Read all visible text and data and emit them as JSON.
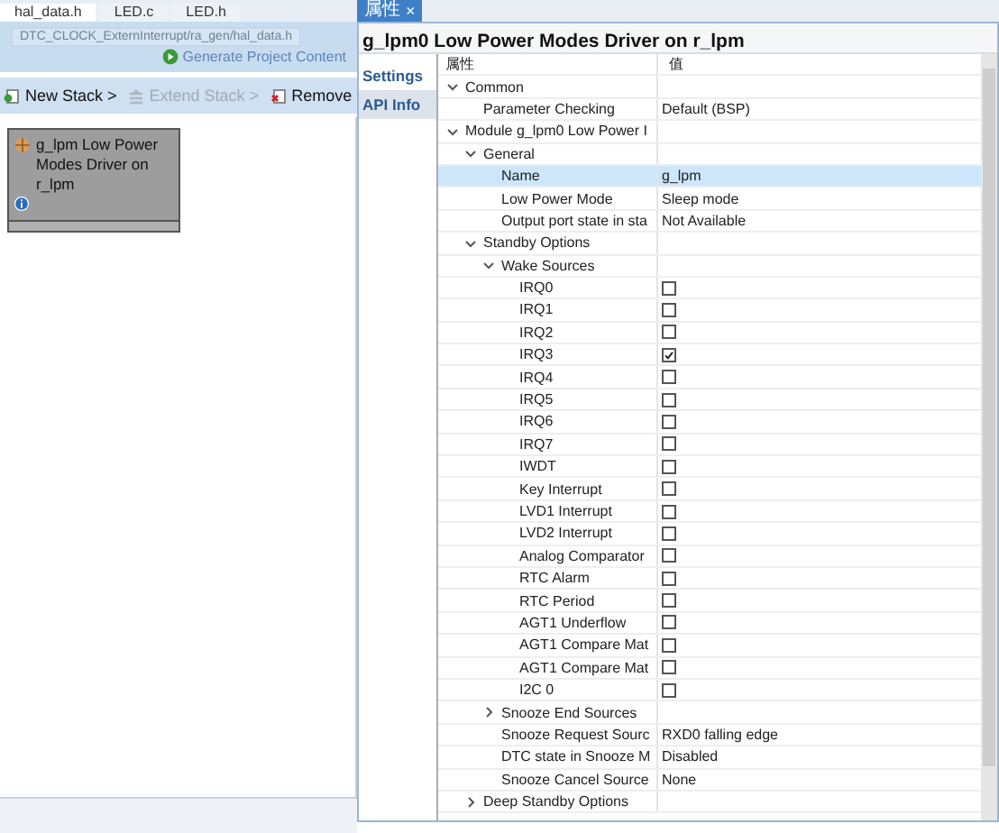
{
  "editor_tabs": [
    {
      "label": "hal_data.h",
      "selected": true
    },
    {
      "label": "LED.c",
      "selected": false
    },
    {
      "label": "LED.h",
      "selected": false
    }
  ],
  "configurator": {
    "path_field": "DTC_CLOCK_ExternInterrupt/ra_gen/hal_data.h",
    "generate_link": "Generate Project Content",
    "toolbar": [
      {
        "label": "New Stack >",
        "disabled": false
      },
      {
        "label": "Extend Stack >",
        "disabled": true
      },
      {
        "label": "Remove",
        "disabled": false
      }
    ],
    "module": {
      "title": "g_lpm Low Power Modes Driver on r_lpm"
    }
  },
  "properties_tab": {
    "label": "属性",
    "close": "×"
  },
  "properties": {
    "title": "g_lpm0 Low Power Modes Driver on r_lpm",
    "side_tabs": [
      {
        "label": "Settings",
        "selected": true
      },
      {
        "label": "API Info",
        "selected": false
      }
    ],
    "columns": [
      "属性",
      "值"
    ],
    "rows": [
      {
        "name": "Common",
        "kind": "group",
        "expanded": true,
        "selected": false,
        "children": [
          {
            "name": "Parameter Checking",
            "kind": "text",
            "value": "Default (BSP)",
            "selected": false
          }
        ]
      },
      {
        "name": "Module g_lpm0 Low Power I",
        "kind": "group",
        "expanded": true,
        "selected": false,
        "children": [
          {
            "name": "General",
            "kind": "group",
            "expanded": true,
            "selected": false,
            "children": [
              {
                "name": "Name",
                "kind": "text",
                "value": "g_lpm",
                "selected": true
              },
              {
                "name": "Low Power Mode",
                "kind": "text",
                "value": "Sleep mode",
                "selected": false
              },
              {
                "name": "Output port state in sta",
                "kind": "text",
                "value": "Not Available",
                "selected": false
              }
            ]
          },
          {
            "name": "Standby Options",
            "kind": "group",
            "expanded": true,
            "selected": false,
            "children": [
              {
                "name": "Wake Sources",
                "kind": "group",
                "expanded": true,
                "selected": false,
                "children": [
                  {
                    "name": "IRQ0",
                    "kind": "checkbox",
                    "checked": false,
                    "selected": false
                  },
                  {
                    "name": "IRQ1",
                    "kind": "checkbox",
                    "checked": false,
                    "selected": false
                  },
                  {
                    "name": "IRQ2",
                    "kind": "checkbox",
                    "checked": false,
                    "selected": false
                  },
                  {
                    "name": "IRQ3",
                    "kind": "checkbox",
                    "checked": true,
                    "selected": false
                  },
                  {
                    "name": "IRQ4",
                    "kind": "checkbox",
                    "checked": false,
                    "selected": false
                  },
                  {
                    "name": "IRQ5",
                    "kind": "checkbox",
                    "checked": false,
                    "selected": false
                  },
                  {
                    "name": "IRQ6",
                    "kind": "checkbox",
                    "checked": false,
                    "selected": false
                  },
                  {
                    "name": "IRQ7",
                    "kind": "checkbox",
                    "checked": false,
                    "selected": false
                  },
                  {
                    "name": "IWDT",
                    "kind": "checkbox",
                    "checked": false,
                    "selected": false
                  },
                  {
                    "name": "Key Interrupt",
                    "kind": "checkbox",
                    "checked": false,
                    "selected": false
                  },
                  {
                    "name": "LVD1 Interrupt",
                    "kind": "checkbox",
                    "checked": false,
                    "selected": false
                  },
                  {
                    "name": "LVD2 Interrupt",
                    "kind": "checkbox",
                    "checked": false,
                    "selected": false
                  },
                  {
                    "name": "Analog Comparator",
                    "kind": "checkbox",
                    "checked": false,
                    "selected": false
                  },
                  {
                    "name": "RTC Alarm",
                    "kind": "checkbox",
                    "checked": false,
                    "selected": false
                  },
                  {
                    "name": "RTC Period",
                    "kind": "checkbox",
                    "checked": false,
                    "selected": false
                  },
                  {
                    "name": "AGT1 Underflow",
                    "kind": "checkbox",
                    "checked": false,
                    "selected": false
                  },
                  {
                    "name": "AGT1 Compare Mat",
                    "kind": "checkbox",
                    "checked": false,
                    "selected": false
                  },
                  {
                    "name": "AGT1 Compare Mat",
                    "kind": "checkbox",
                    "checked": false,
                    "selected": false
                  },
                  {
                    "name": "I2C 0",
                    "kind": "checkbox",
                    "checked": false,
                    "selected": false
                  }
                ]
              },
              {
                "name": "Snooze End Sources",
                "kind": "group",
                "expanded": false,
                "selected": false
              },
              {
                "name": "Snooze Request Sourc",
                "kind": "text",
                "value": "RXD0 falling edge",
                "selected": false
              },
              {
                "name": "DTC state in Snooze M",
                "kind": "text",
                "value": "Disabled",
                "selected": false
              },
              {
                "name": "Snooze Cancel Source",
                "kind": "text",
                "value": "None",
                "selected": false
              }
            ]
          },
          {
            "name": "Deep Standby Options",
            "kind": "group",
            "expanded": false,
            "selected": false
          }
        ]
      }
    ]
  }
}
